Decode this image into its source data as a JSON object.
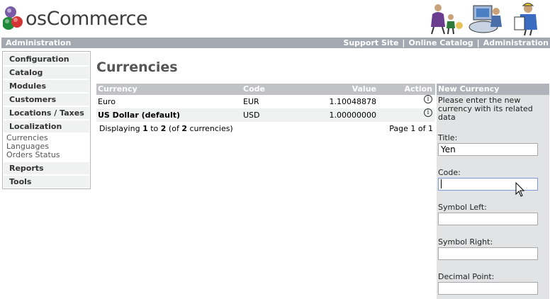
{
  "header": {
    "logo_text": "osCommerce",
    "logo_icon": "oscommerce-logo-icon",
    "art_icon": "people-illustration-icon"
  },
  "topbar": {
    "title": "Administration",
    "links": [
      "Support Site",
      "Online Catalog",
      "Administration"
    ],
    "separator": "|"
  },
  "sidebar": {
    "items": [
      {
        "label": "Configuration"
      },
      {
        "label": "Catalog"
      },
      {
        "label": "Modules"
      },
      {
        "label": "Customers"
      },
      {
        "label": "Locations / Taxes"
      },
      {
        "label": "Localization"
      },
      {
        "label": "Reports"
      },
      {
        "label": "Tools"
      }
    ],
    "localization_subitems": [
      "Currencies",
      "Languages",
      "Orders Status"
    ]
  },
  "main": {
    "title": "Currencies",
    "columns": {
      "currency": "Currency",
      "code": "Code",
      "value": "Value",
      "action": "Action"
    },
    "rows": [
      {
        "currency": "Euro",
        "code": "EUR",
        "value": "1.10048878",
        "action_icon": "info-icon"
      },
      {
        "currency": "US Dollar (default)",
        "code": "USD",
        "value": "1.00000000",
        "action_icon": "info-icon"
      }
    ],
    "footer": {
      "displaying_prefix": "Displaying ",
      "from": "1",
      "to_word": " to ",
      "to": "2",
      "of_prefix": " (of ",
      "total": "2",
      "of_suffix": " currencies)",
      "page_text": "Page 1 of 1"
    }
  },
  "panel": {
    "title": "New Currency",
    "description": "Please enter the new currency with its related data",
    "fields": [
      {
        "label": "Title:",
        "value": "Yen"
      },
      {
        "label": "Code:",
        "value": ""
      },
      {
        "label": "Symbol Left:",
        "value": ""
      },
      {
        "label": "Symbol Right:",
        "value": ""
      },
      {
        "label": "Decimal Point:",
        "value": ""
      }
    ]
  },
  "colors": {
    "topbar": "#a3a8b1",
    "table_header": "#c0c2c5",
    "panel_bg": "#e1e3e4",
    "panel_header": "#b0b4ba",
    "sidebar_item": "#f0f1f1"
  }
}
